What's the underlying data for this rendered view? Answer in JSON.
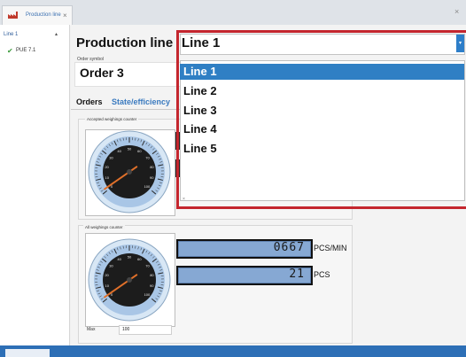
{
  "tab": {
    "title": "Production line",
    "close": "×"
  },
  "window": {
    "close": "×"
  },
  "tree": {
    "line": "Line 1",
    "caret": "▴",
    "item": "PUE 7.1",
    "check": "✔"
  },
  "header": {
    "production_line_label": "Production line",
    "order_symbol_label": "Order symbol",
    "order_value": "Order 3"
  },
  "tabs": [
    {
      "label": "Orders"
    },
    {
      "label": "State/efficiency"
    }
  ],
  "combo": {
    "selected": "Line 1",
    "button": "▾"
  },
  "dropdown": {
    "items": [
      "Line 1",
      "Line 2",
      "Line 3",
      "Line 4",
      "Line 5"
    ],
    "selected_index": 0,
    "grip": "×"
  },
  "groups": {
    "accepted_title": "Accepted weighings counter",
    "all_title": "All weighings counter"
  },
  "readouts": [
    {
      "value": "0667",
      "unit": "PCS/MIN"
    },
    {
      "value": "21",
      "unit": "PCS"
    }
  ],
  "max": {
    "label": "Max",
    "value": "100"
  },
  "gauge": {
    "ticks": [
      "0",
      "10",
      "20",
      "30",
      "40",
      "50",
      "60",
      "70",
      "80",
      "90",
      "100"
    ]
  },
  "colors": {
    "accent": "#2f7fc4",
    "highlight_border": "#c4262e",
    "lcd": "#86a8d3",
    "needle": "#e0702a"
  }
}
